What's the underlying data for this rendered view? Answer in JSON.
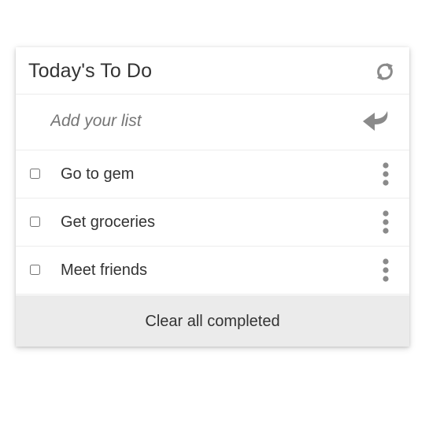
{
  "header": {
    "title": "Today's To Do",
    "refresh_icon": "refresh-icon"
  },
  "add": {
    "placeholder": "Add your list",
    "enter_icon": "enter-arrow-icon"
  },
  "items": [
    {
      "label": "Go to gem",
      "checked": false
    },
    {
      "label": "Get groceries",
      "checked": false
    },
    {
      "label": "Meet friends",
      "checked": false
    }
  ],
  "footer": {
    "clear_label": "Clear all completed"
  },
  "colors": {
    "text": "#333333",
    "icon": "#888888",
    "footer_bg": "#ebebeb",
    "divider": "#ececec"
  }
}
